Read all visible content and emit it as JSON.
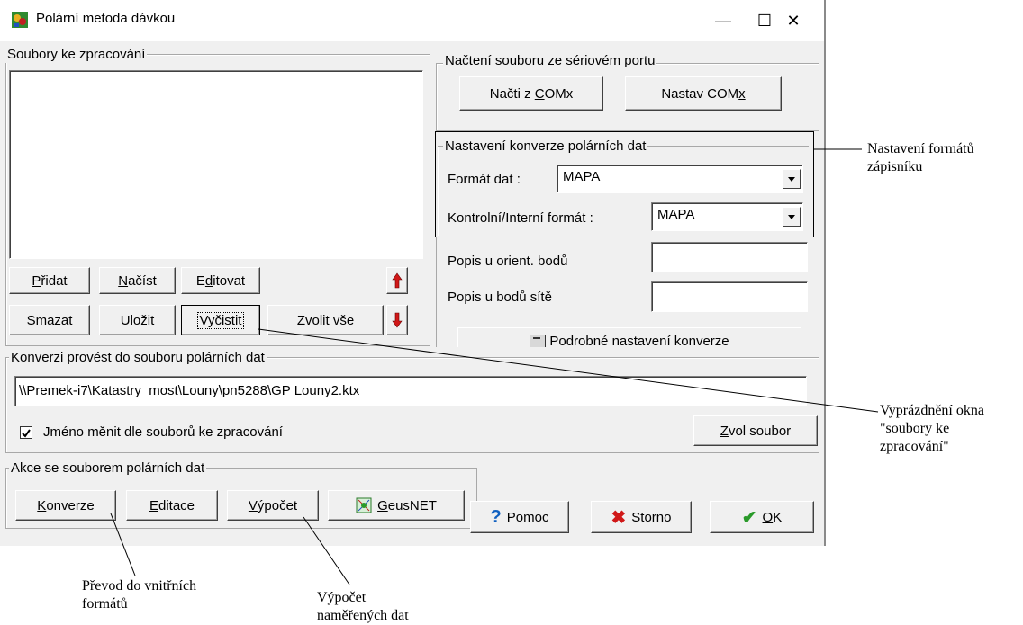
{
  "window": {
    "title": "Polární metoda dávkou",
    "minimize_glyph": "—",
    "maximize_glyph": "☐",
    "close_glyph": "✕"
  },
  "files_group": {
    "label": "Soubory ke zpracování",
    "buttons": {
      "pridat_u": "P",
      "pridat_rest": "řidat",
      "nacist_u": "N",
      "nacist_rest": "ačíst",
      "editovat_a": "E",
      "editovat_u": "d",
      "editovat_rest": "itovat",
      "smazat_u": "S",
      "smazat_rest": "mazat",
      "ulozit_u": "U",
      "ulozit_rest": "ložit",
      "vycistit_a": "Vy",
      "vycistit_u": "č",
      "vycistit_rest": "istit",
      "zvolit_vse": "Zvolit vše"
    }
  },
  "serial_group": {
    "label": "Načtení souboru ze sériovém portu",
    "nacti_a": "Načti z ",
    "nacti_u": "C",
    "nacti_rest": "OMx",
    "nastav_a": "Nastav COM",
    "nastav_u": "x"
  },
  "conversion_group": {
    "label": "Nastavení konverze polárních dat",
    "format_label": "Formát dat :",
    "format_value": "MAPA",
    "control_label": "Kontrolní/Interní formát :",
    "control_value": "MAPA"
  },
  "descriptions": {
    "orient_label": "Popis u orient. bodů",
    "orient_value": "",
    "network_label": "Popis u bodů sítě",
    "network_value": "",
    "detail_button": "Podrobné nastavení konverze"
  },
  "output_group": {
    "label": "Konverzi provést do souboru polárních dat",
    "path": "\\\\Premek-i7\\Katastry_most\\Louny\\pn5288\\GP Louny2.ktx",
    "checkbox_checked": true,
    "checkbox_label": "Jméno měnit dle souborů ke zpracování",
    "choose_u": "Z",
    "choose_rest": "vol soubor"
  },
  "actions_group": {
    "label": "Akce se souborem polárních dat",
    "konverze_u": "K",
    "konverze_rest": "onverze",
    "editace_u": "E",
    "editace_rest": "ditace",
    "vypocet_u": "V",
    "vypocet_rest": "ýpočet",
    "geusnet_u": "G",
    "geusnet_rest": "eusNET"
  },
  "dialog_buttons": {
    "help": "Pomoc",
    "cancel": "Storno",
    "ok_u": "O",
    "ok_rest": "K"
  },
  "annotations": {
    "format_note_line1": "Nastavení formátů",
    "format_note_line2": "zápisníku",
    "clear_note_line1": "Vyprázdnění okna",
    "clear_note_line2": "\"soubory ke",
    "clear_note_line3": "zpracování\"",
    "convert_note_line1": "Převod do vnitřních",
    "convert_note_line2": "formátů",
    "compute_note_line1": "Výpočet",
    "compute_note_line2": "naměřených dat"
  },
  "colors": {
    "window_bg": "#f0f0f0",
    "help_icon": "#1060c0",
    "cancel_icon": "#d01818",
    "ok_icon": "#2a9a2a",
    "arrow_up_down": "#d01818"
  }
}
